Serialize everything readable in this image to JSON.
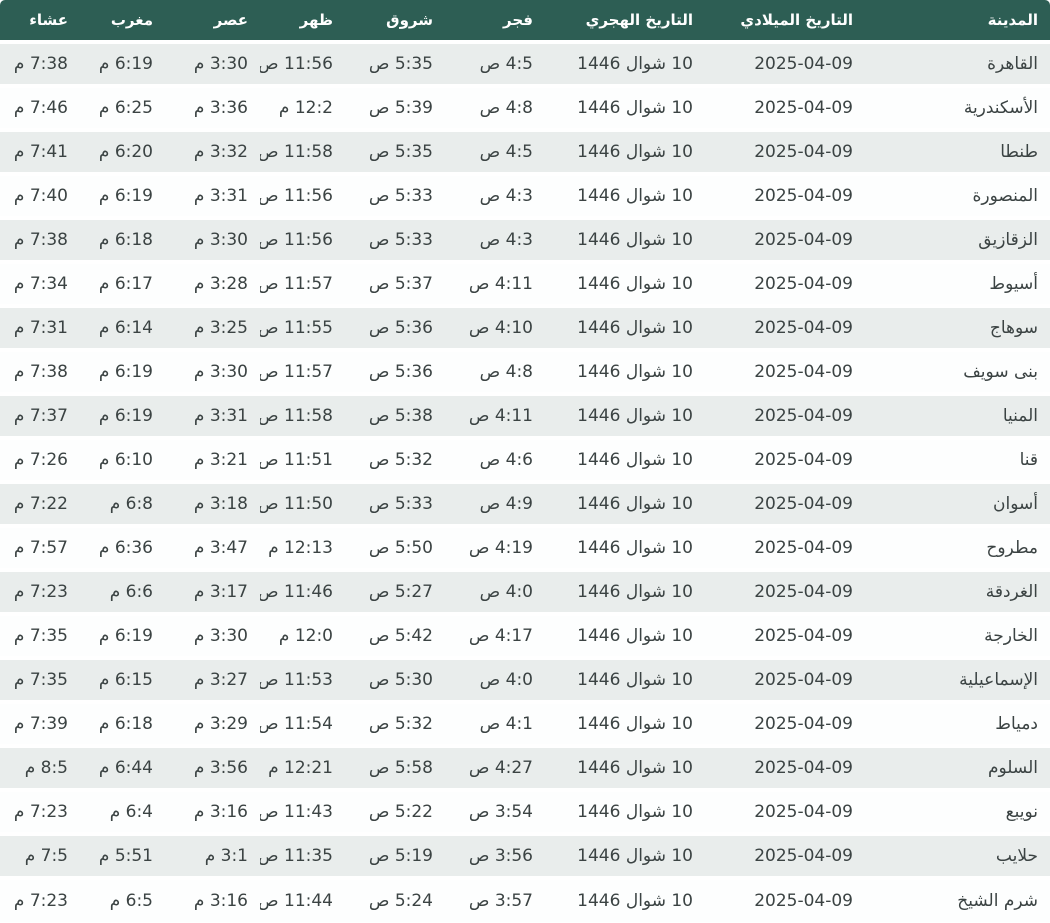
{
  "colors": {
    "header_bg": "#2d5e54",
    "header_text": "#ffffff",
    "row_alt_bg": "#e9edec",
    "row_bg": "#fdfefe",
    "cell_text": "#3b4343"
  },
  "table": {
    "columns": [
      {
        "key": "city",
        "label": "المدينة"
      },
      {
        "key": "gregorian_date",
        "label": "التاريخ الميلادي"
      },
      {
        "key": "hijri_date",
        "label": "التاريخ الهجري"
      },
      {
        "key": "fajr",
        "label": "فجر"
      },
      {
        "key": "shurooq",
        "label": "شروق"
      },
      {
        "key": "dhuhr",
        "label": "ظهر"
      },
      {
        "key": "asr",
        "label": "عصر"
      },
      {
        "key": "maghrib",
        "label": "مغرب"
      },
      {
        "key": "isha",
        "label": "عشاء"
      }
    ],
    "rows": [
      {
        "city": "القاهرة",
        "gregorian_date": "2025-04-09",
        "hijri_date": "10 شوال 1446",
        "fajr": "4:5 ص",
        "shurooq": "5:35 ص",
        "dhuhr": "11:56 ص",
        "asr": "3:30 م",
        "maghrib": "6:19 م",
        "isha": "7:38 م"
      },
      {
        "city": "الأسكندرية",
        "gregorian_date": "2025-04-09",
        "hijri_date": "10 شوال 1446",
        "fajr": "4:8 ص",
        "shurooq": "5:39 ص",
        "dhuhr": "12:2 م",
        "asr": "3:36 م",
        "maghrib": "6:25 م",
        "isha": "7:46 م"
      },
      {
        "city": "طنطا",
        "gregorian_date": "2025-04-09",
        "hijri_date": "10 شوال 1446",
        "fajr": "4:5 ص",
        "shurooq": "5:35 ص",
        "dhuhr": "11:58 ص",
        "asr": "3:32 م",
        "maghrib": "6:20 م",
        "isha": "7:41 م"
      },
      {
        "city": "المنصورة",
        "gregorian_date": "2025-04-09",
        "hijri_date": "10 شوال 1446",
        "fajr": "4:3 ص",
        "shurooq": "5:33 ص",
        "dhuhr": "11:56 ص",
        "asr": "3:31 م",
        "maghrib": "6:19 م",
        "isha": "7:40 م"
      },
      {
        "city": "الزقازيق",
        "gregorian_date": "2025-04-09",
        "hijri_date": "10 شوال 1446",
        "fajr": "4:3 ص",
        "shurooq": "5:33 ص",
        "dhuhr": "11:56 ص",
        "asr": "3:30 م",
        "maghrib": "6:18 م",
        "isha": "7:38 م"
      },
      {
        "city": "أسيوط",
        "gregorian_date": "2025-04-09",
        "hijri_date": "10 شوال 1446",
        "fajr": "4:11 ص",
        "shurooq": "5:37 ص",
        "dhuhr": "11:57 ص",
        "asr": "3:28 م",
        "maghrib": "6:17 م",
        "isha": "7:34 م"
      },
      {
        "city": "سوهاج",
        "gregorian_date": "2025-04-09",
        "hijri_date": "10 شوال 1446",
        "fajr": "4:10 ص",
        "shurooq": "5:36 ص",
        "dhuhr": "11:55 ص",
        "asr": "3:25 م",
        "maghrib": "6:14 م",
        "isha": "7:31 م"
      },
      {
        "city": "بنى سويف",
        "gregorian_date": "2025-04-09",
        "hijri_date": "10 شوال 1446",
        "fajr": "4:8 ص",
        "shurooq": "5:36 ص",
        "dhuhr": "11:57 ص",
        "asr": "3:30 م",
        "maghrib": "6:19 م",
        "isha": "7:38 م"
      },
      {
        "city": "المنيا",
        "gregorian_date": "2025-04-09",
        "hijri_date": "10 شوال 1446",
        "fajr": "4:11 ص",
        "shurooq": "5:38 ص",
        "dhuhr": "11:58 ص",
        "asr": "3:31 م",
        "maghrib": "6:19 م",
        "isha": "7:37 م"
      },
      {
        "city": "قنا",
        "gregorian_date": "2025-04-09",
        "hijri_date": "10 شوال 1446",
        "fajr": "4:6 ص",
        "shurooq": "5:32 ص",
        "dhuhr": "11:51 ص",
        "asr": "3:21 م",
        "maghrib": "6:10 م",
        "isha": "7:26 م"
      },
      {
        "city": "أسوان",
        "gregorian_date": "2025-04-09",
        "hijri_date": "10 شوال 1446",
        "fajr": "4:9 ص",
        "shurooq": "5:33 ص",
        "dhuhr": "11:50 ص",
        "asr": "3:18 م",
        "maghrib": "6:8 م",
        "isha": "7:22 م"
      },
      {
        "city": "مطروح",
        "gregorian_date": "2025-04-09",
        "hijri_date": "10 شوال 1446",
        "fajr": "4:19 ص",
        "shurooq": "5:50 ص",
        "dhuhr": "12:13 م",
        "asr": "3:47 م",
        "maghrib": "6:36 م",
        "isha": "7:57 م"
      },
      {
        "city": "الغردقة",
        "gregorian_date": "2025-04-09",
        "hijri_date": "10 شوال 1446",
        "fajr": "4:0 ص",
        "shurooq": "5:27 ص",
        "dhuhr": "11:46 ص",
        "asr": "3:17 م",
        "maghrib": "6:6 م",
        "isha": "7:23 م"
      },
      {
        "city": "الخارجة",
        "gregorian_date": "2025-04-09",
        "hijri_date": "10 شوال 1446",
        "fajr": "4:17 ص",
        "shurooq": "5:42 ص",
        "dhuhr": "12:0 م",
        "asr": "3:30 م",
        "maghrib": "6:19 م",
        "isha": "7:35 م"
      },
      {
        "city": "الإسماعيلية",
        "gregorian_date": "2025-04-09",
        "hijri_date": "10 شوال 1446",
        "fajr": "4:0 ص",
        "shurooq": "5:30 ص",
        "dhuhr": "11:53 ص",
        "asr": "3:27 م",
        "maghrib": "6:15 م",
        "isha": "7:35 م"
      },
      {
        "city": "دمياط",
        "gregorian_date": "2025-04-09",
        "hijri_date": "10 شوال 1446",
        "fajr": "4:1 ص",
        "shurooq": "5:32 ص",
        "dhuhr": "11:54 ص",
        "asr": "3:29 م",
        "maghrib": "6:18 م",
        "isha": "7:39 م"
      },
      {
        "city": "السلوم",
        "gregorian_date": "2025-04-09",
        "hijri_date": "10 شوال 1446",
        "fajr": "4:27 ص",
        "shurooq": "5:58 ص",
        "dhuhr": "12:21 م",
        "asr": "3:56 م",
        "maghrib": "6:44 م",
        "isha": "8:5 م"
      },
      {
        "city": "نويبع",
        "gregorian_date": "2025-04-09",
        "hijri_date": "10 شوال 1446",
        "fajr": "3:54 ص",
        "shurooq": "5:22 ص",
        "dhuhr": "11:43 ص",
        "asr": "3:16 م",
        "maghrib": "6:4 م",
        "isha": "7:23 م"
      },
      {
        "city": "حلايب",
        "gregorian_date": "2025-04-09",
        "hijri_date": "10 شوال 1446",
        "fajr": "3:56 ص",
        "shurooq": "5:19 ص",
        "dhuhr": "11:35 ص",
        "asr": "3:1 م",
        "maghrib": "5:51 م",
        "isha": "7:5 م"
      },
      {
        "city": "شرم الشيخ",
        "gregorian_date": "2025-04-09",
        "hijri_date": "10 شوال 1446",
        "fajr": "3:57 ص",
        "shurooq": "5:24 ص",
        "dhuhr": "11:44 ص",
        "asr": "3:16 م",
        "maghrib": "6:5 م",
        "isha": "7:23 م"
      }
    ]
  }
}
